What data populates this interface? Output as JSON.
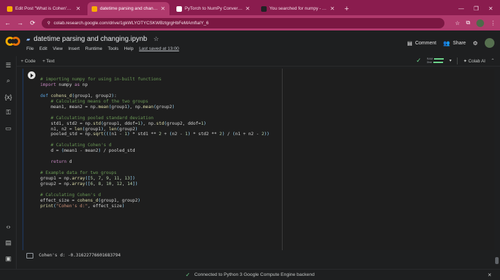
{
  "browser": {
    "tabs": [
      {
        "title": "Edit Post \"What is Cohen's D a",
        "color": "#f9ab00",
        "active": false
      },
      {
        "title": "datetime parsing and changing",
        "color": "#f9ab00",
        "active": true
      },
      {
        "title": "PyTorch to NumPy Conversion",
        "color": "#ffffff",
        "active": false
      },
      {
        "title": "You searched for numpy - Ask",
        "color": "#202124",
        "active": false
      }
    ],
    "new_tab_glyph": "+",
    "window_controls": [
      "—",
      "❐",
      "✕"
    ],
    "url": "colab.research.google.com/drive/1gkWLYOTYCSKWBztgrgHbFeMAmfIaIY_6",
    "nav": {
      "back": "←",
      "forward": "→",
      "reload": "⟳"
    },
    "ext_icons": [
      "☆",
      "⧉",
      "⋮"
    ]
  },
  "colab": {
    "notebook_title": "datetime parsing and changing.ipynb",
    "menu": [
      "File",
      "Edit",
      "View",
      "Insert",
      "Runtime",
      "Tools",
      "Help"
    ],
    "last_saved": "Last saved at 13:00",
    "header_buttons": {
      "comment": "Comment",
      "share": "Share"
    },
    "toolbar": {
      "add_code": "+ Code",
      "add_text": "+ Text",
      "ram_label": "RAM",
      "disk_label": "Disk",
      "colab_ai": "Colab AI"
    },
    "rail_icons": [
      "menu-icon",
      "search-icon",
      "variables-icon",
      "secrets-key-icon",
      "files-icon",
      "code-snippets-icon",
      "command-palette-icon",
      "terminal-icon"
    ]
  },
  "cell": {
    "lines": [
      "# importing numpy for using in-built functions",
      "import numpy as np",
      "",
      "def cohens_d(group1, group2):",
      "    # Calculating means of the two groups",
      "    mean1, mean2 = np.mean(group1), np.mean(group2)",
      "",
      "    # Calculating pooled standard deviation",
      "    std1, std2 = np.std(group1, ddof=1), np.std(group2, ddof=1)",
      "    n1, n2 = len(group1), len(group2)",
      "    pooled_std = np.sqrt(((n1 - 1) * std1 ** 2 + (n2 - 1) * std2 ** 2) / (n1 + n2 - 2))",
      "",
      "    # Calculating Cohen's d",
      "    d = (mean1 - mean2) / pooled_std",
      "",
      "    return d",
      "",
      "# Example data for two groups",
      "group1 = np.array([5, 7, 9, 11, 13])",
      "group2 = np.array([6, 8, 10, 12, 14])",
      "",
      "# Calculating Cohen's d",
      "effect_size = cohens_d(group1, group2)",
      "print(\"Cohen's d:\", effect_size)"
    ],
    "output": "Cohen's d: -0.31622776601683794"
  },
  "status": {
    "text": "Connected to Python 3 Google Compute Engine backend",
    "check": "✓",
    "close": "✕"
  }
}
